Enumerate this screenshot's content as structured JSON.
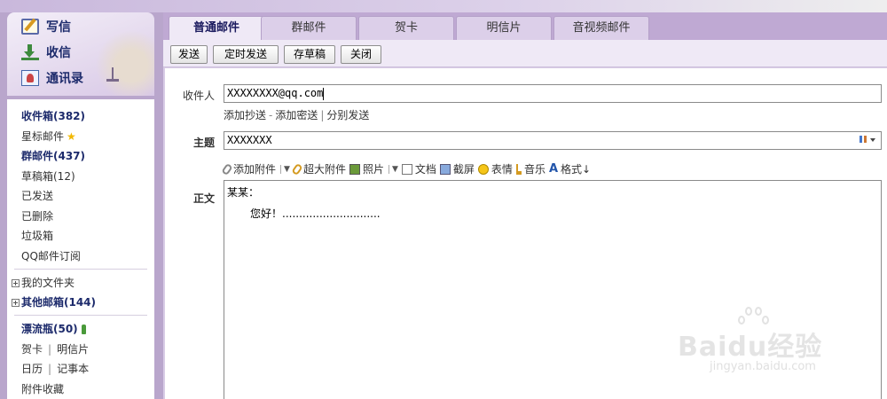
{
  "sidebar": {
    "compose": {
      "write": "写信",
      "inbox": "收信",
      "contacts": "通讯录"
    },
    "folders": {
      "inbox": "收件箱(382)",
      "starred": "星标邮件",
      "group_mail": "群邮件(437)",
      "drafts": "草稿箱(12)",
      "sent": "已发送",
      "deleted": "已删除",
      "spam": "垃圾箱",
      "subscriptions": "QQ邮件订阅",
      "my_folders": "我的文件夹",
      "other_mailboxes": "其他邮箱(144)",
      "drift_bottle": "漂流瓶(50)",
      "greeting_card": "贺卡",
      "postcard": "明信片",
      "calendar": "日历",
      "notebook": "记事本",
      "attachments": "附件收藏"
    }
  },
  "tabs": [
    "普通邮件",
    "群邮件",
    "贺卡",
    "明信片",
    "音视频邮件"
  ],
  "active_tab": "普通邮件",
  "toolbar": {
    "send": "发送",
    "scheduled_send": "定时发送",
    "save_draft": "存草稿",
    "close": "关闭"
  },
  "form": {
    "to_label": "收件人",
    "to_value": "XXXXXXXX@qq.com",
    "links": {
      "add_cc": "添加抄送",
      "add_bcc": "添加密送",
      "separate_send": "分别发送"
    },
    "subject_label": "主题",
    "subject_value": "XXXXXXX",
    "editor_tools": {
      "add_attachment": "添加附件",
      "large_attachment": "超大附件",
      "photo": "照片",
      "document": "文档",
      "screenshot": "截屏",
      "emoji": "表情",
      "music": "音乐",
      "format": "格式↓"
    },
    "body_label": "正文",
    "body_line1": "某某：",
    "body_line2": "您好！............................."
  },
  "watermark": {
    "brand": "Baidu经验",
    "url": "jingyan.baidu.com"
  },
  "colors": {
    "accent": "#bfa9d3",
    "panel": "#efe9f6",
    "nav_text": "#1c2a6b"
  }
}
